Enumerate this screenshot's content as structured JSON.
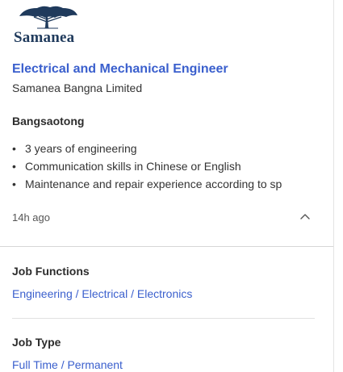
{
  "logo": {
    "wordmark": "Samanea"
  },
  "job": {
    "title": "Electrical and Mechanical Engineer",
    "company": "Samanea Bangna Limited",
    "location": "Bangsaotong",
    "highlights": [
      "3 years of engineering",
      "Communication skills in Chinese or English",
      "Maintenance and repair experience according to sp"
    ],
    "posted": "14h ago",
    "collapse_icon": "chevron-up-icon"
  },
  "details": {
    "job_functions": {
      "heading": "Job Functions",
      "items": [
        "Engineering",
        "Electrical",
        "Electronics"
      ],
      "separator": "/"
    },
    "job_type": {
      "heading": "Job Type",
      "items": [
        "Full Time",
        "Permanent"
      ],
      "separator": "/"
    }
  },
  "colors": {
    "link": "#3a5fcd",
    "logo": "#1f3a5c",
    "text": "#2d2d2d"
  }
}
